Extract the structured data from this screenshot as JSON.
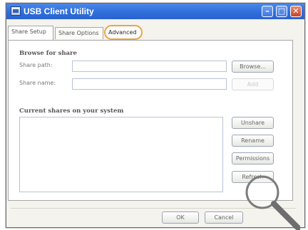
{
  "window": {
    "title": "USB Client Utility"
  },
  "title_buttons": {
    "minimize": "–",
    "maximize": "□",
    "close": "✕"
  },
  "tabs": [
    {
      "label": "Share Setup",
      "active": true
    },
    {
      "label": "Share Options",
      "active": false
    },
    {
      "label": "Advanced",
      "active": false,
      "highlighted": true
    }
  ],
  "browse": {
    "title": "Browse for share",
    "share_path_label": "Share path:",
    "share_path_value": "",
    "browse_button": "Browse...",
    "share_name_label": "Share name:",
    "share_name_value": "",
    "add_button": "Add"
  },
  "current": {
    "title": "Current shares on your system",
    "items": [],
    "unshare_button": "Unshare",
    "rename_button": "Rename",
    "permissions_button": "Permissions",
    "refresh_button": "Refresh"
  },
  "footer": {
    "ok_button": "OK",
    "cancel_button": "Cancel"
  },
  "colors": {
    "titlebar": "#2f6fdc",
    "highlight_ring": "#e8a44a",
    "magnifier_handle": "#7c7c7c"
  },
  "icons": {
    "app": "app-icon",
    "magnifier": "magnifier-icon"
  }
}
